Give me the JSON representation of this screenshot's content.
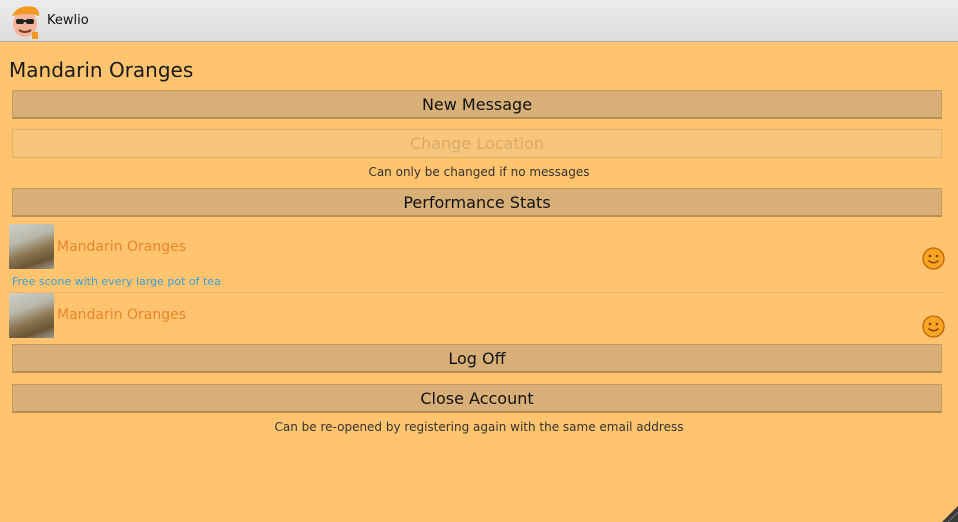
{
  "window": {
    "app_title": "Kewlio"
  },
  "page": {
    "title": "Mandarin Oranges"
  },
  "actions": {
    "new_message": "New Message",
    "change_location": "Change Location",
    "change_location_hint": "Can only be changed if no messages",
    "performance_stats": "Performance Stats",
    "log_off": "Log Off",
    "close_account": "Close Account",
    "close_account_hint": "Can be re-opened by registering again with the same email address"
  },
  "messages": [
    {
      "location": "Mandarin Oranges",
      "text": "Free scone with every large pot of tea",
      "status_icon": "smiley-icon"
    },
    {
      "location": "Mandarin Oranges",
      "text": "",
      "status_icon": "smiley-icon"
    }
  ],
  "colors": {
    "background": "#ffc46d",
    "button": "#d8b077",
    "location_text": "#e8852a",
    "offer_text": "#3aa0d8"
  }
}
